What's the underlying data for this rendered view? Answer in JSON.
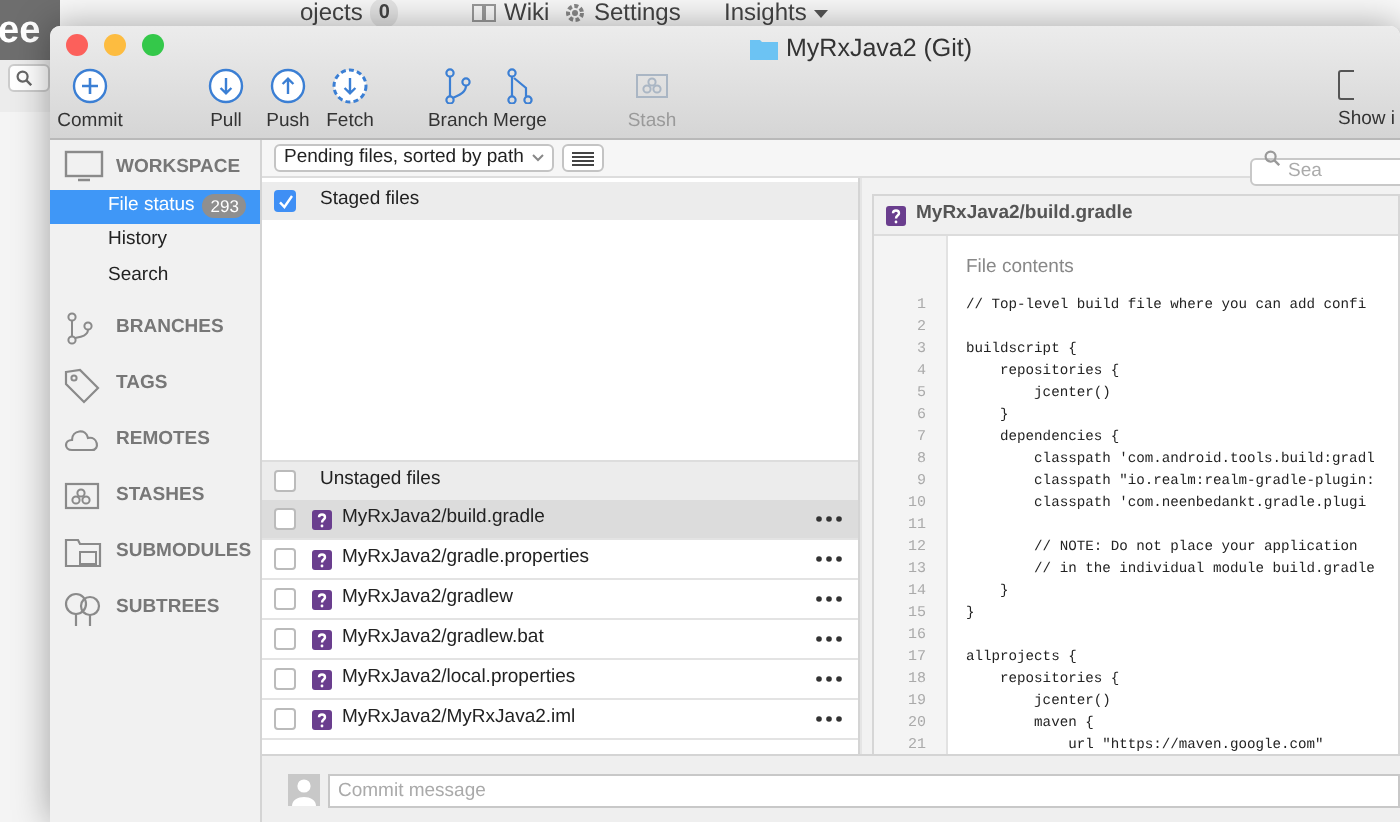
{
  "background_app": {
    "brand": "ee",
    "search": {
      "kind": "field"
    },
    "nav": [
      {
        "label": "ojects",
        "count": "0"
      },
      {
        "label": "Wiki"
      },
      {
        "label": "Settings"
      },
      {
        "label": "Insights"
      }
    ]
  },
  "window": {
    "title": "MyRxJava2 (Git)"
  },
  "toolbar": {
    "groups": [
      [
        {
          "label": "Commit",
          "disabled": false
        }
      ],
      [
        {
          "label": "Pull",
          "disabled": false
        },
        {
          "label": "Push",
          "disabled": false
        },
        {
          "label": "Fetch",
          "disabled": false
        }
      ],
      [
        {
          "label": "Branch",
          "disabled": false
        },
        {
          "label": "Merge",
          "disabled": false
        }
      ],
      [
        {
          "label": "Stash",
          "disabled": true
        }
      ]
    ],
    "right": {
      "label": "Show i"
    }
  },
  "filter_bar": {
    "dropdown": "Pending files, sorted by path",
    "search": {
      "placeholder": "Sea"
    }
  },
  "sidebar": {
    "sections": [
      {
        "label": "WORKSPACE",
        "children": [
          {
            "label": "File status",
            "badge": "293",
            "selected": true
          },
          {
            "label": "History",
            "selected": false
          },
          {
            "label": "Search",
            "selected": false
          }
        ]
      },
      {
        "label": "BRANCHES"
      },
      {
        "label": "TAGS"
      },
      {
        "label": "REMOTES"
      },
      {
        "label": "STASHES"
      },
      {
        "label": "SUBMODULES"
      },
      {
        "label": "SUBTREES"
      }
    ]
  },
  "staged": {
    "label": "Staged files",
    "checked": true
  },
  "unstaged": {
    "label": "Unstaged files",
    "checked": false,
    "files": [
      {
        "path": "MyRxJava2/build.gradle",
        "checked": false,
        "selected": true
      },
      {
        "path": "MyRxJava2/gradle.properties",
        "checked": false,
        "selected": false
      },
      {
        "path": "MyRxJava2/gradlew",
        "checked": false,
        "selected": false
      },
      {
        "path": "MyRxJava2/gradlew.bat",
        "checked": false,
        "selected": false
      },
      {
        "path": "MyRxJava2/local.properties",
        "checked": false,
        "selected": false
      },
      {
        "path": "MyRxJava2/MyRxJava2.iml",
        "checked": false,
        "selected": false
      }
    ]
  },
  "commit": {
    "placeholder": "Commit message"
  },
  "preview": {
    "title": "MyRxJava2/build.gradle",
    "subtitle": "File contents",
    "lines": [
      {
        "number": "1",
        "text": "// Top-level build file where you can add confi"
      },
      {
        "number": "2"
      },
      {
        "number": "3",
        "text": "buildscript {"
      },
      {
        "number": "4",
        "text": "    repositories {"
      },
      {
        "number": "5",
        "text": "        jcenter()"
      },
      {
        "number": "6",
        "text": "    }"
      },
      {
        "number": "7",
        "text": "    dependencies {"
      },
      {
        "number": "8",
        "text": "        classpath 'com.android.tools.build:gradl"
      },
      {
        "number": "9",
        "text": "        classpath \"io.realm:realm-gradle-plugin:"
      },
      {
        "number": "10",
        "text": "        classpath 'com.neenbedankt.gradle.plugi"
      },
      {
        "number": "11"
      },
      {
        "number": "12",
        "text": "        // NOTE: Do not place your application"
      },
      {
        "number": "13",
        "text": "        // in the individual module build.gradle"
      },
      {
        "number": "14",
        "text": "    }"
      },
      {
        "number": "15",
        "text": "}"
      },
      {
        "number": "16"
      },
      {
        "number": "17",
        "text": "allprojects {"
      },
      {
        "number": "18",
        "text": "    repositories {"
      },
      {
        "number": "19",
        "text": "        jcenter()"
      },
      {
        "number": "20",
        "text": "        maven {"
      },
      {
        "number": "21",
        "text": "            url \"https://maven.google.com\""
      }
    ]
  }
}
